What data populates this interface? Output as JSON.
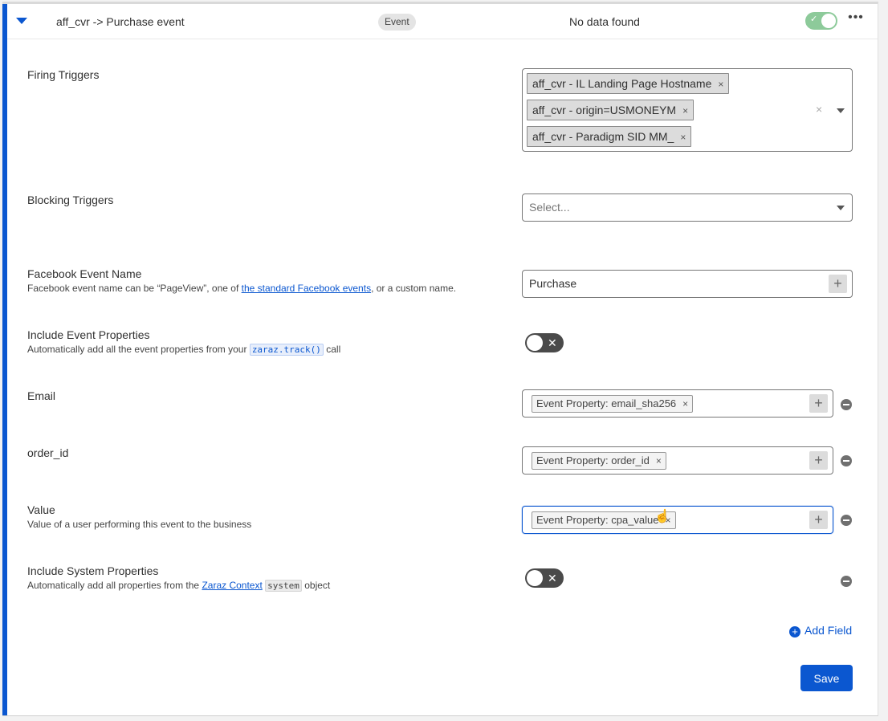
{
  "header": {
    "title": "aff_cvr -> Purchase event",
    "type_badge": "Event",
    "status": "No data found",
    "enabled": true
  },
  "firing_triggers": {
    "label": "Firing Triggers",
    "chips": [
      "aff_cvr - IL Landing Page Hostname",
      "aff_cvr - origin=USMONEYM",
      "aff_cvr - Paradigm SID MM_"
    ]
  },
  "blocking_triggers": {
    "label": "Blocking Triggers",
    "placeholder": "Select..."
  },
  "event_name": {
    "label": "Facebook Event Name",
    "desc_prefix": "Facebook event name can be “PageView”, one of ",
    "desc_link": "the standard Facebook events",
    "desc_suffix": ", or a custom name.",
    "value": "Purchase"
  },
  "include_event_props": {
    "label": "Include Event Properties",
    "desc_prefix": "Automatically add all the event properties from your ",
    "desc_code": "zaraz.track()",
    "desc_suffix": " call",
    "enabled": false
  },
  "fields": [
    {
      "label": "Email",
      "chip": "Event Property: email_sha256"
    },
    {
      "label": "order_id",
      "chip": "Event Property: order_id"
    },
    {
      "label": "Value",
      "desc": "Value of a user performing this event to the business",
      "chip": "Event Property: cpa_value"
    }
  ],
  "include_system_props": {
    "label": "Include System Properties",
    "desc_prefix": "Automatically add all properties from the ",
    "desc_link": "Zaraz Context",
    "desc_code": "system",
    "desc_suffix": " object",
    "enabled": false
  },
  "actions": {
    "add_field": "Add Field",
    "save": "Save"
  },
  "colors": {
    "accent": "#0b57d0",
    "toggle_on": "#8dca9a",
    "toggle_off": "#4a4a4a"
  }
}
